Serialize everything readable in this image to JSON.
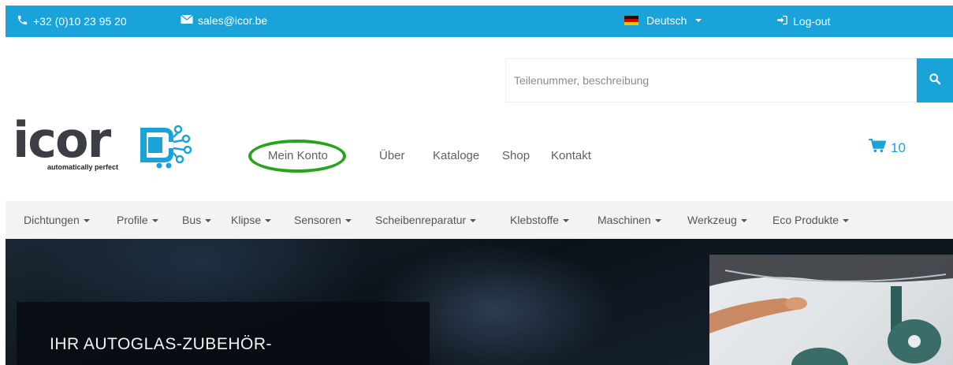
{
  "topbar": {
    "phone": "+32 (0)10 23 95 20",
    "email": "sales@icor.be",
    "language": "Deutsch",
    "logout": "Log-out"
  },
  "search": {
    "placeholder": "Teilenummer, beschreibung"
  },
  "logo": {
    "name": "icor",
    "tagline": "automatically perfect"
  },
  "main_nav": [
    {
      "label": "Mein Konto"
    },
    {
      "label": "Über"
    },
    {
      "label": "Kataloge"
    },
    {
      "label": "Shop"
    },
    {
      "label": "Kontakt"
    }
  ],
  "cart": {
    "count": "10"
  },
  "categories": [
    {
      "label": "Dichtungen"
    },
    {
      "label": "Profile"
    },
    {
      "label": "Bus"
    },
    {
      "label": "Klipse"
    },
    {
      "label": "Sensoren"
    },
    {
      "label": "Scheibenreparatur"
    },
    {
      "label": "Klebstoffe"
    },
    {
      "label": "Maschinen"
    },
    {
      "label": "Werkzeug"
    },
    {
      "label": "Eco Produkte"
    }
  ],
  "hero": {
    "title": "IHR AUTOGLAS-ZUBEHÖR-"
  },
  "colors": {
    "accent": "#1aa3d9",
    "highlight": "#27a31f",
    "text": "#606060"
  },
  "icons": [
    "phone-icon",
    "mail-icon",
    "german-flag-icon",
    "login-icon",
    "search-icon",
    "cart-icon"
  ]
}
